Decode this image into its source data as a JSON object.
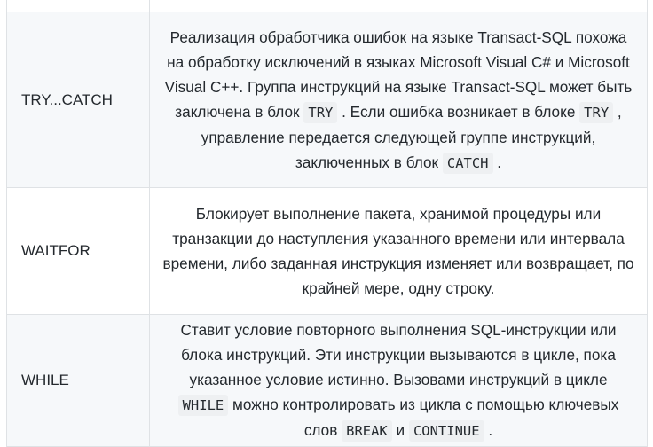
{
  "rows": [
    {
      "name": "TRY...CATCH",
      "desc": [
        {
          "t": "text",
          "v": "Реализация обработчика ошибок на языке Transact-SQL похожа на обработку исключений в языках Microsoft Visual C# и Microsoft Visual C++. Группа инструкций на языке Transact-SQL может быть заключена в блок "
        },
        {
          "t": "code",
          "v": "TRY"
        },
        {
          "t": "text",
          "v": " . Если ошибка возникает в блоке "
        },
        {
          "t": "code",
          "v": "TRY"
        },
        {
          "t": "text",
          "v": " , управление передается следующей группе инструкций, заключенных в блок "
        },
        {
          "t": "code",
          "v": "CATCH"
        },
        {
          "t": "text",
          "v": " ."
        }
      ]
    },
    {
      "name": "WAITFOR",
      "desc": [
        {
          "t": "text",
          "v": "Блокирует выполнение пакета, хранимой процедуры или транзакции до наступления указанного времени или интервала времени, либо заданная инструкция изменяет или возвращает, по крайней мере, одну строку."
        }
      ]
    },
    {
      "name": "WHILE",
      "desc": [
        {
          "t": "text",
          "v": "Ставит условие повторного выполнения SQL-инструкции или блока инструкций. Эти инструкции вызываются в цикле, пока указанное условие истинно. Вызовами инструкций в цикле "
        },
        {
          "t": "code",
          "v": "WHILE"
        },
        {
          "t": "text",
          "v": " можно контролировать из цикла с помощью ключевых слов "
        },
        {
          "t": "code",
          "v": "BREAK"
        },
        {
          "t": "text",
          "v": " и "
        },
        {
          "t": "code",
          "v": "CONTINUE"
        },
        {
          "t": "text",
          "v": " ."
        }
      ]
    }
  ]
}
